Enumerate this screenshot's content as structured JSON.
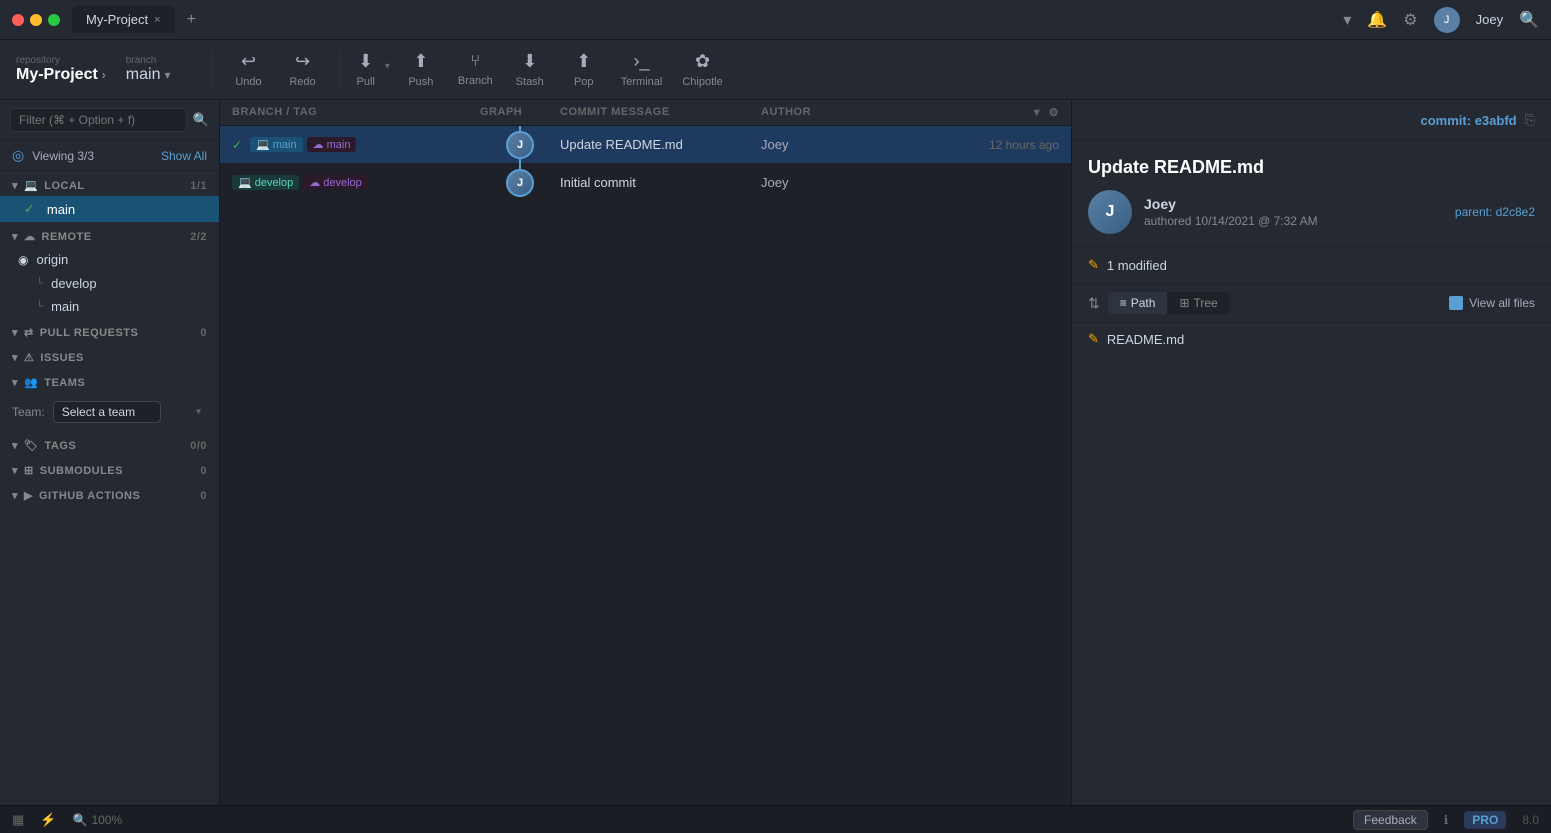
{
  "app": {
    "title": "My-Project",
    "tab_label": "My-Project",
    "close_btn": "×",
    "new_tab_btn": "+"
  },
  "titlebar": {
    "dropdown_icon": "▾",
    "bell_icon": "🔔",
    "gear_icon": "⚙",
    "user_name": "Joey",
    "user_initials": "J",
    "search_icon": "🔍"
  },
  "toolbar": {
    "repo_label": "repository",
    "repo_name": "My-Project",
    "branch_label": "branch",
    "branch_name": "main",
    "undo_label": "Undo",
    "redo_label": "Redo",
    "pull_label": "Pull",
    "push_label": "Push",
    "branch_btn_label": "Branch",
    "stash_label": "Stash",
    "pop_label": "Pop",
    "terminal_label": "Terminal",
    "chipotle_label": "Chipotle"
  },
  "sidebar": {
    "filter_placeholder": "Filter (⌘ + Option + f)",
    "viewing_text": "Viewing 3/3",
    "show_all": "Show All",
    "local_label": "LOCAL",
    "local_count": "1/1",
    "main_branch": "main",
    "remote_label": "REMOTE",
    "remote_count": "2/2",
    "origin_label": "origin",
    "develop_branch": "develop",
    "remote_main": "main",
    "pull_requests_label": "PULL REQUESTS",
    "pull_requests_count": "0",
    "issues_label": "ISSUES",
    "teams_label": "TEAMS",
    "team_select_placeholder": "Select a team",
    "tags_label": "TAGS",
    "tags_count": "0/0",
    "submodules_label": "SUBMODULES",
    "submodules_count": "0",
    "github_actions_label": "GITHUB ACTIONS",
    "github_actions_count": "0"
  },
  "commit_table": {
    "col_branch_tag": "BRANCH / TAG",
    "col_graph": "GRAPH",
    "col_message": "COMMIT MESSAGE",
    "col_author": "AUTHOR",
    "commits": [
      {
        "branch": "main",
        "has_check": true,
        "message": "Update README.md",
        "author": "Joey",
        "time": "12 hours ago",
        "selected": true
      },
      {
        "branch": "develop",
        "has_check": false,
        "message": "Initial commit",
        "author": "Joey",
        "time": "",
        "selected": false
      }
    ]
  },
  "detail": {
    "commit_label": "commit: ",
    "commit_hash": "e3abfd",
    "parent_label": "parent: ",
    "parent_hash": "d2c8e2",
    "commit_title": "Update README.md",
    "author_name": "Joey",
    "author_initials": "J",
    "authored_label": "authored",
    "authored_date": "10/14/2021 @ 7:32 AM",
    "modified_label": "1 modified",
    "path_label": "Path",
    "tree_label": "Tree",
    "view_all_files": "View all files",
    "sort_icon": "⇅",
    "files": [
      {
        "name": "README.md",
        "status": "modified"
      }
    ]
  },
  "statusbar": {
    "grid_icon": "▦",
    "network_icon": "⚡",
    "zoom_icon": "🔍",
    "zoom_level": "100%",
    "feedback_label": "Feedback",
    "pro_label": "PRO",
    "version": "8.0"
  }
}
